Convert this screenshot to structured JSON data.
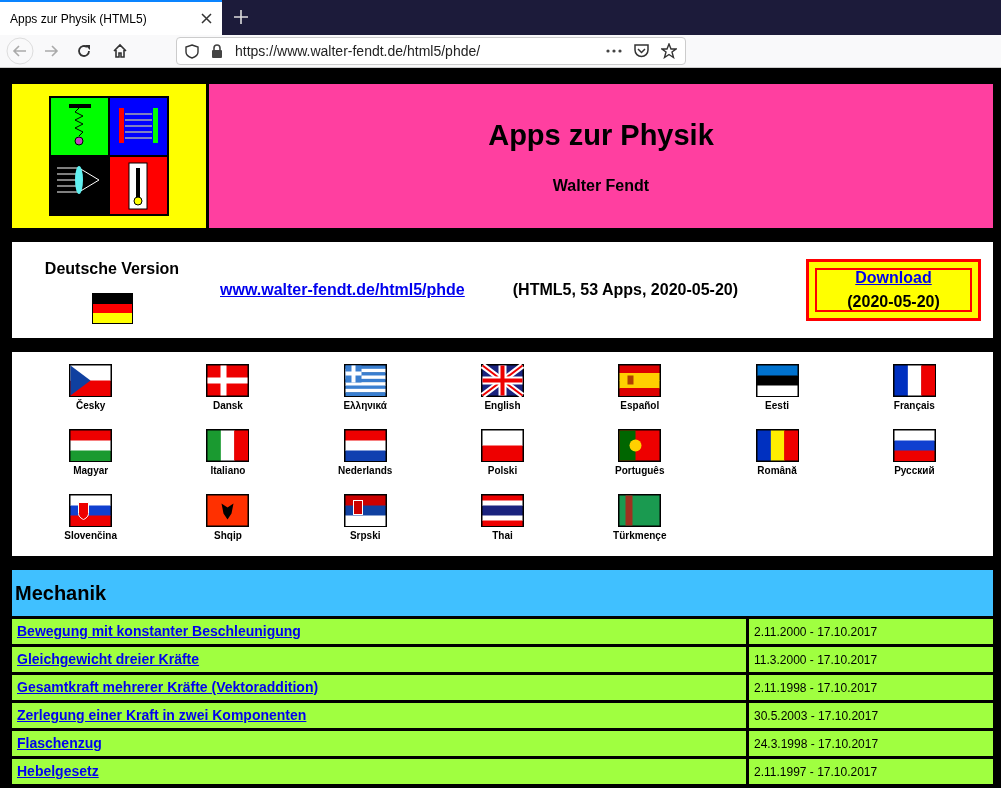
{
  "browser": {
    "tab_title": "Apps zur Physik (HTML5)",
    "url": "https://www.walter-fendt.de/html5/phde/"
  },
  "header": {
    "title": "Apps zur Physik",
    "author": "Walter Fendt"
  },
  "version": {
    "label": "Deutsche Version",
    "link": "www.walter-fendt.de/html5/phde",
    "info": "(HTML5, 53 Apps, 2020-05-20)",
    "download": "Download",
    "download_date": "(2020-05-20)"
  },
  "languages": [
    "Česky",
    "Dansk",
    "Ελληνικά",
    "English",
    "Español",
    "Eesti",
    "Français",
    "Magyar",
    "Italiano",
    "Nederlands",
    "Polski",
    "Português",
    "Română",
    "Русский",
    "Slovenčina",
    "Shqip",
    "Srpski",
    "Thai",
    "Türkmençe"
  ],
  "section": {
    "title": "Mechanik",
    "rows": [
      {
        "app": "Bewegung mit konstanter Beschleunigung",
        "dates": "2.11.2000 - 17.10.2017"
      },
      {
        "app": "Gleichgewicht dreier Kräfte",
        "dates": "11.3.2000 - 17.10.2017"
      },
      {
        "app": "Gesamtkraft mehrerer Kräfte (Vektoraddition)",
        "dates": "2.11.1998 - 17.10.2017"
      },
      {
        "app": "Zerlegung einer Kraft in zwei Komponenten",
        "dates": "30.5.2003 - 17.10.2017"
      },
      {
        "app": "Flaschenzug",
        "dates": "24.3.1998 - 17.10.2017"
      },
      {
        "app": "Hebelgesetz",
        "dates": "2.11.1997 - 17.10.2017"
      }
    ]
  }
}
